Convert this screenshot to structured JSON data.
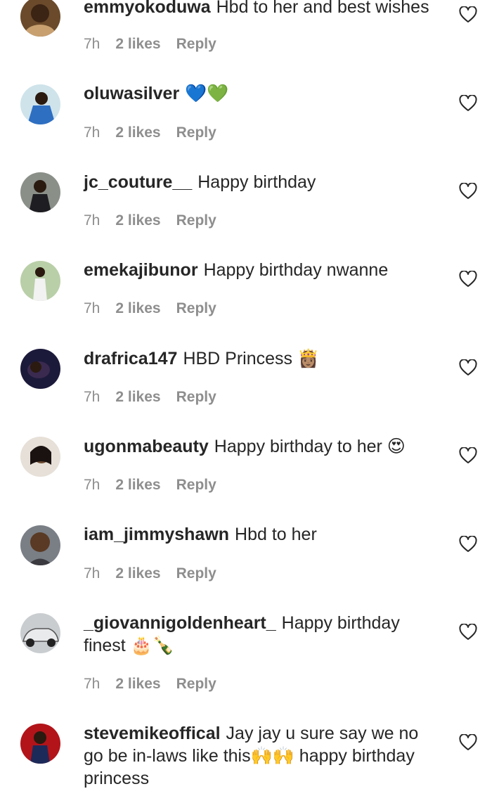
{
  "comments": [
    {
      "username": "emmyokoduwa",
      "text": "Hbd to her and best wishes",
      "time": "7h",
      "likes": "2 likes",
      "reply": "Reply"
    },
    {
      "username": "oluwasilver",
      "text": "💙💚",
      "time": "7h",
      "likes": "2 likes",
      "reply": "Reply"
    },
    {
      "username": "jc_couture__",
      "text": "Happy birthday",
      "time": "7h",
      "likes": "2 likes",
      "reply": "Reply"
    },
    {
      "username": "emekajibunor",
      "text": "Happy birthday nwanne",
      "time": "7h",
      "likes": "2 likes",
      "reply": "Reply"
    },
    {
      "username": "drafrica147",
      "text": "HBD Princess 👸🏽",
      "time": "7h",
      "likes": "2 likes",
      "reply": "Reply"
    },
    {
      "username": "ugonmabeauty",
      "text": "Happy birthday to her 😍",
      "time": "7h",
      "likes": "2 likes",
      "reply": "Reply"
    },
    {
      "username": "iam_jimmyshawn",
      "text": "Hbd to her",
      "time": "7h",
      "likes": "2 likes",
      "reply": "Reply"
    },
    {
      "username": "_giovannigoldenheart_",
      "text": "Happy birthday finest 🎂🍾",
      "time": "7h",
      "likes": "2 likes",
      "reply": "Reply"
    },
    {
      "username": "stevemikeoffical",
      "text": "Jay jay u sure say we no go be in-laws like this🙌🙌 happy birthday princess"
    }
  ],
  "icons": {
    "like": "heart-outline-icon"
  },
  "colors": {
    "text": "#262626",
    "meta": "#8e8e8e",
    "background": "#ffffff"
  }
}
